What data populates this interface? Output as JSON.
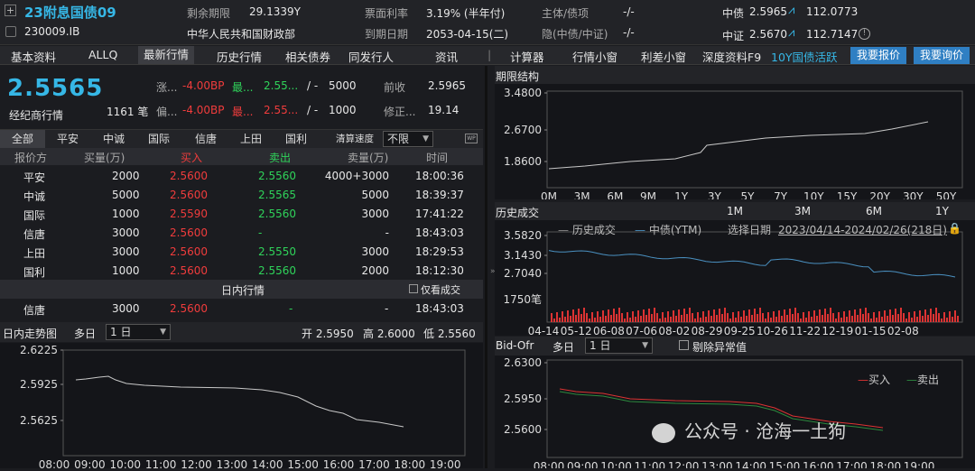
{
  "header": {
    "title": "23附息国债09",
    "code": "230009.IB",
    "remain_label": "剩余期限",
    "remain_value": "29.1339Y",
    "issuer": "中华人民共和国财政部",
    "coupon_label": "票面利率",
    "coupon_value": "3.19% (半年付)",
    "maturity_label": "到期日期",
    "maturity_value": "2053-04-15(二)",
    "rating_label": "主体/债项",
    "rating_value": "-/-",
    "implied_label": "隐(中债/中证)",
    "implied_value": "-/-",
    "zz_label": "中债",
    "zz_yield": "2.5965",
    "zz_price": "112.0773",
    "zzh_label": "中证",
    "zzh_yield": "2.5670",
    "zzh_price": "112.7147"
  },
  "tabs": [
    "基本资料",
    "ALLQ",
    "最新行情",
    "历史行情",
    "相关债券",
    "同发行人",
    "资讯",
    "|",
    "计算器",
    "行情小窗",
    "利差小窗",
    "深度资料F9"
  ],
  "tab_highlight": "10Y国债活跃",
  "btn_quote": "我要报价",
  "btn_inquiry": "我要询价",
  "quote": {
    "price": "2.5565",
    "sub": "经纪商行情",
    "count": "1161 笔",
    "chg_label": "涨...",
    "chg_value": "-4.00BP",
    "dev_label": "偏...",
    "dev_value": "-4.00BP",
    "best1": "最...",
    "best1_val": "2.55...",
    "slash1": "/ -",
    "vol1": "5000",
    "best2": "最...",
    "best2_val": "2.55...",
    "slash2": "/ -",
    "vol2": "1000",
    "prev_label": "前收",
    "prev_value": "2.5965",
    "dur_label": "修正...",
    "dur_value": "19.14"
  },
  "broker_tabs": [
    "全部",
    "平安",
    "中诚",
    "国际",
    "信唐",
    "上田",
    "国利"
  ],
  "speed_label": "清算速度",
  "speed_value": "不限",
  "table_headers": [
    "报价方",
    "买量(万)",
    "买入",
    "卖出",
    "卖量(万)",
    "时间"
  ],
  "rows": [
    {
      "n": "平安",
      "bv": "2000",
      "b": "2.5600",
      "s": "2.5560",
      "sv": "4000+3000",
      "t": "18:00:36"
    },
    {
      "n": "中诚",
      "bv": "5000",
      "b": "2.5600",
      "s": "2.5565",
      "sv": "5000",
      "t": "18:39:37"
    },
    {
      "n": "国际",
      "bv": "1000",
      "b": "2.5590",
      "s": "2.5560",
      "sv": "3000",
      "t": "17:41:22"
    },
    {
      "n": "信唐",
      "bv": "3000",
      "b": "2.5600",
      "s": "-",
      "sv": "-",
      "t": "18:43:03"
    },
    {
      "n": "上田",
      "bv": "3000",
      "b": "2.5600",
      "s": "2.5550",
      "sv": "3000",
      "t": "18:29:53"
    },
    {
      "n": "国利",
      "bv": "1000",
      "b": "2.5600",
      "s": "2.5560",
      "sv": "2000",
      "t": "18:12:30"
    }
  ],
  "intraday_title": "日内行情",
  "only_deal": "仅看成交",
  "intraday_row": {
    "n": "信唐",
    "bv": "3000",
    "b": "2.5600",
    "s": "-",
    "sv": "-",
    "t": "18:43:03"
  },
  "trend": {
    "title": "日内走势图",
    "period_label": "多日",
    "period_value": "1 日",
    "open": "开 2.5950",
    "high": "高 2.6000",
    "low": "低 2.5560",
    "y_ticks": [
      "2.6225",
      "2.5925",
      "2.5625"
    ],
    "x_ticks": [
      "08:00",
      "09:00",
      "10:00",
      "11:00",
      "12:00",
      "13:00",
      "14:00",
      "15:00",
      "16:00",
      "17:00",
      "18:00",
      "19:00"
    ]
  },
  "term": {
    "title": "期限结构",
    "y_ticks": [
      "3.4800",
      "2.6700",
      "1.8600"
    ],
    "x_ticks": [
      "0M",
      "3M",
      "6M",
      "9M",
      "1Y",
      "3Y",
      "5Y",
      "7Y",
      "10Y",
      "15Y",
      "20Y",
      "30Y",
      "50Y"
    ]
  },
  "hist": {
    "title": "历史成交",
    "ranges": [
      "1M",
      "3M",
      "6M",
      "1Y"
    ],
    "legend1": "历史成交",
    "legend2": "中债(YTM)",
    "date_label": "选择日期",
    "date_range": "2023/04/14-2024/02/26(218日)",
    "y_ticks": [
      "3.5820",
      "3.1430",
      "2.7040"
    ],
    "vol_label": "1750笔",
    "x_ticks": [
      "04-14",
      "05-12",
      "06-08",
      "07-06",
      "08-02",
      "08-29",
      "09-25",
      "10-26",
      "11-22",
      "12-19",
      "01-15",
      "02-08"
    ]
  },
  "bidofr": {
    "title": "Bid-Ofr",
    "period_label": "多日",
    "period_value": "1 日",
    "remove_outlier": "剔除异常值",
    "legend_buy": "买入",
    "legend_sell": "卖出",
    "y_ticks": [
      "2.6300",
      "2.5950",
      "2.5600"
    ],
    "x_ticks": [
      "08:00",
      "09:00",
      "10:00",
      "11:00",
      "12:00",
      "13:00",
      "14:00",
      "15:00",
      "16:00",
      "17:00",
      "18:00",
      "19:00"
    ]
  },
  "watermark": "公众号 · 沧海一土狗"
}
